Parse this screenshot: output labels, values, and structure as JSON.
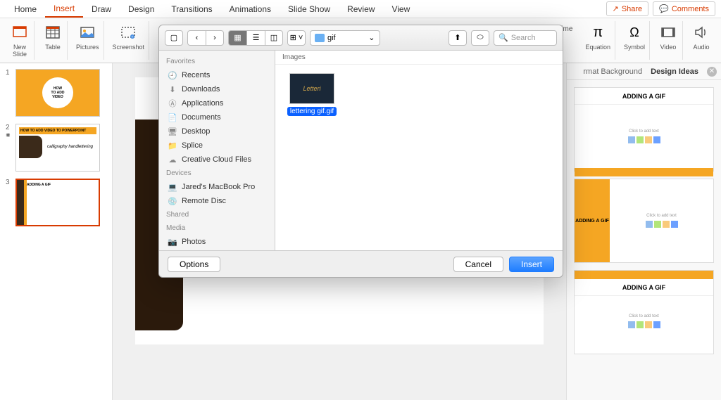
{
  "menu": {
    "items": [
      "Home",
      "Insert",
      "Draw",
      "Design",
      "Transitions",
      "Animations",
      "Slide Show",
      "Review",
      "View"
    ],
    "active_index": 1,
    "share": "Share",
    "comments": "Comments"
  },
  "ribbon": {
    "new_slide": "New\nSlide",
    "table": "Table",
    "pictures": "Pictures",
    "screenshot": "Screenshot",
    "date_time": "Date & Time",
    "equation": "Equation",
    "symbol": "Symbol",
    "video": "Video",
    "audio": "Audio"
  },
  "slides": {
    "s1_badge": "HOW\nTO ADD\nVIDEO",
    "s2_header": "HOW TO ADD VIDEO TO POWERPOINT",
    "s2_script": "calligraphy handlettering",
    "s3_title": "ADDING A GIF"
  },
  "design_panel": {
    "tab_format": "rmat Background",
    "tab_ideas": "Design Ideas",
    "suggestion_title": "ADDING A GIF",
    "placeholder_text": "Click to add text"
  },
  "dialog": {
    "path_label": "gif",
    "search_placeholder": "Search",
    "sidebar": {
      "favorites_label": "Favorites",
      "favorites": [
        "Recents",
        "Downloads",
        "Applications",
        "Documents",
        "Desktop",
        "Splice",
        "Creative Cloud Files"
      ],
      "devices_label": "Devices",
      "devices": [
        "Jared's MacBook Pro",
        "Remote Disc"
      ],
      "shared_label": "Shared",
      "media_label": "Media",
      "media": [
        "Photos"
      ]
    },
    "content_header": "Images",
    "file_name": "lettering gif.gif",
    "options_btn": "Options",
    "cancel_btn": "Cancel",
    "insert_btn": "Insert"
  }
}
